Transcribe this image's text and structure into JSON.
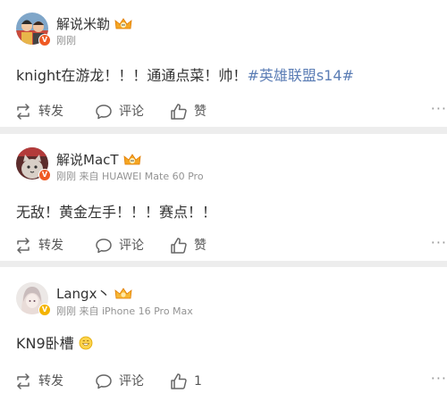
{
  "posts": [
    {
      "author": "解说米勒",
      "verified_badge": "V",
      "meta": "刚刚",
      "content_text": "knight在游龙！！！通通点菜！帅！",
      "topic": "#英雄联盟s14#",
      "actions": {
        "repost": "转发",
        "comment": "评论",
        "like": "赞"
      }
    },
    {
      "author": "解说MacT",
      "verified_badge": "V",
      "meta": "刚刚 来自 HUAWEI Mate 60 Pro",
      "content_text": "无敌！黄金左手！！！赛点！！",
      "actions": {
        "repost": "转发",
        "comment": "评论",
        "like": "赞"
      }
    },
    {
      "author": "Langx丶",
      "verified_badge": "V",
      "meta": "刚刚 来自 iPhone 16 Pro Max",
      "content_text": "KN9卧槽",
      "emoji": "grinning-face-emoji",
      "actions": {
        "repost": "转发",
        "comment": "评论",
        "like": "1"
      }
    }
  ],
  "icons": {
    "repost": "repost-icon",
    "comment": "comment-icon",
    "like": "thumbs-up-icon",
    "more": "more-icon",
    "level": "crown-level-icon"
  },
  "colors": {
    "topic": "#5b7db5",
    "meta": "#939393",
    "orange_badge": "#ef5a24",
    "gold_badge": "#f4b400"
  }
}
